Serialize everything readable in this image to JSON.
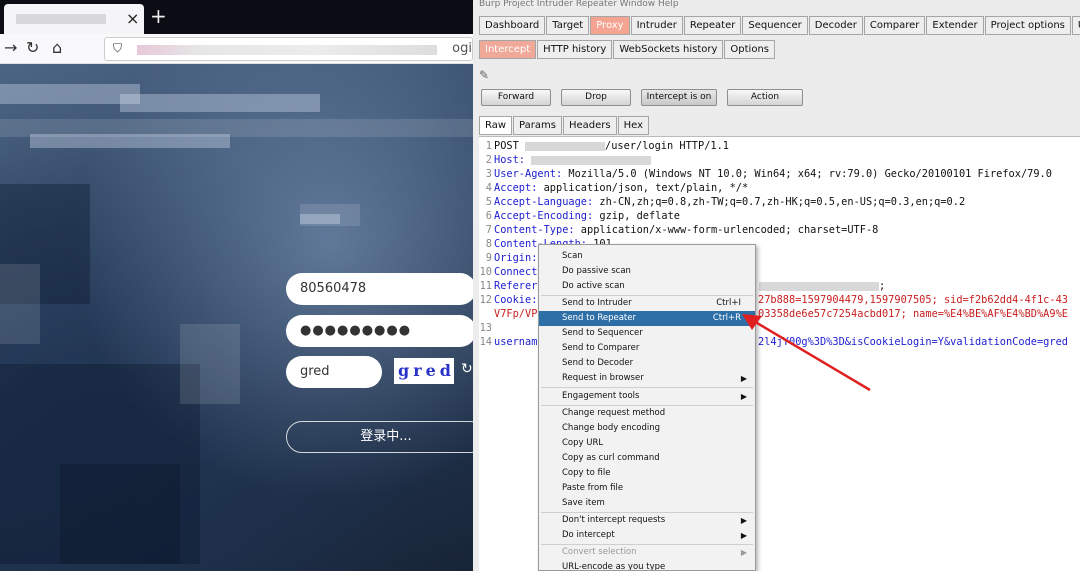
{
  "browser": {
    "tab_close": "×",
    "new_tab": "+",
    "url_tail": "ogi",
    "login": {
      "username": "80560478",
      "password": "●●●●●●●●●",
      "captcha_input": "gred",
      "captcha_image_text": "gred",
      "submit_label": "登录中..."
    }
  },
  "burp": {
    "menubar": "Burp  Project  Intruder  Repeater  Window  Help",
    "main_tabs": [
      "Dashboard",
      "Target",
      "Proxy",
      "Intruder",
      "Repeater",
      "Sequencer",
      "Decoder",
      "Comparer",
      "Extender",
      "Project options",
      "User options"
    ],
    "proxy_tabs": [
      "Intercept",
      "HTTP history",
      "WebSockets history",
      "Options"
    ],
    "buttons": {
      "forward": "Forward",
      "drop": "Drop",
      "intercept": "Intercept is on",
      "action": "Action"
    },
    "view_tabs": [
      "Raw",
      "Params",
      "Headers",
      "Hex"
    ],
    "request": {
      "l1_method": "POST",
      "l1_path": "/user/login HTTP/1.1",
      "host_key": "Host:",
      "ua_key": "User-Agent:",
      "ua_val": " Mozilla/5.0 (Windows NT 10.0; Win64; x64; rv:79.0) Gecko/20100101 Firefox/79.0",
      "accept_key": "Accept:",
      "accept_val": " application/json, text/plain, */*",
      "lang_key": "Accept-Language:",
      "lang_val": " zh-CN,zh;q=0.8,zh-TW;q=0.7,zh-HK;q=0.5,en-US;q=0.3,en;q=0.2",
      "enc_key": "Accept-Encoding:",
      "enc_val": " gzip, deflate",
      "ctype_key": "Content-Type:",
      "ctype_val": " application/x-www-form-urlencoded; charset=UTF-8",
      "clen_key": "Content-Length:",
      "clen_val": " 101",
      "origin_key": "Origin:",
      "conn_key": "Connecti",
      "ref_key": "Referer:",
      "ref_tail": ";",
      "cookie_key": "Cookie:",
      "cookie_val": "27b888=1597904479,1597907505; sid=f2b62dd4-4f1c-43",
      "l12b_left": "V7Fp/VPS",
      "l12b_right": "03358de6e57c7254acbd017; name=%E4%BE%AF%E4%BD%A9%E",
      "body_key": "username",
      "body_val": "2l4jY00g%3D%3D&isCookieLogin=Y&validationCode=gred"
    },
    "context_menu": {
      "items": [
        {
          "label": "Scan",
          "shortcut": "",
          "arrow": false
        },
        {
          "label": "Do passive scan",
          "shortcut": "",
          "arrow": false
        },
        {
          "label": "Do active scan",
          "shortcut": "",
          "arrow": false
        },
        {
          "label": "Send to Intruder",
          "shortcut": "Ctrl+I",
          "arrow": false
        },
        {
          "label": "Send to Repeater",
          "shortcut": "Ctrl+R",
          "arrow": false
        },
        {
          "label": "Send to Sequencer",
          "shortcut": "",
          "arrow": false
        },
        {
          "label": "Send to Comparer",
          "shortcut": "",
          "arrow": false
        },
        {
          "label": "Send to Decoder",
          "shortcut": "",
          "arrow": false
        },
        {
          "label": "Request in browser",
          "shortcut": "",
          "arrow": true
        },
        {
          "label": "Engagement tools",
          "shortcut": "",
          "arrow": true
        },
        {
          "label": "Change request method",
          "shortcut": "",
          "arrow": false
        },
        {
          "label": "Change body encoding",
          "shortcut": "",
          "arrow": false
        },
        {
          "label": "Copy URL",
          "shortcut": "",
          "arrow": false
        },
        {
          "label": "Copy as curl command",
          "shortcut": "",
          "arrow": false
        },
        {
          "label": "Copy to file",
          "shortcut": "",
          "arrow": false
        },
        {
          "label": "Paste from file",
          "shortcut": "",
          "arrow": false
        },
        {
          "label": "Save item",
          "shortcut": "",
          "arrow": false
        },
        {
          "label": "Don't intercept requests",
          "shortcut": "",
          "arrow": true
        },
        {
          "label": "Do intercept",
          "shortcut": "",
          "arrow": true
        },
        {
          "label": "Convert selection",
          "shortcut": "",
          "arrow": true
        },
        {
          "label": "URL-encode as you type",
          "shortcut": "",
          "arrow": false
        }
      ]
    }
  },
  "colors": {
    "accent_tab": "#f4a490",
    "keyword_blue": "#1d1dd2",
    "value_red": "#c81e1e",
    "menu_highlight": "#2e6fa8",
    "arrow_red": "#e02020"
  }
}
